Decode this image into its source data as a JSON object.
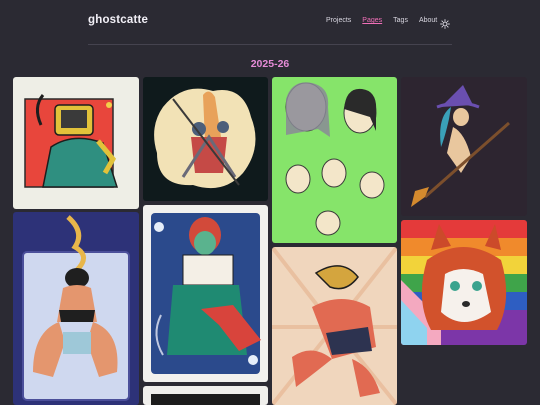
{
  "site": {
    "name": "ghostcatte"
  },
  "nav": {
    "items": [
      {
        "label": "Projects"
      },
      {
        "label": "Pages"
      },
      {
        "label": "Tags"
      },
      {
        "label": "About"
      }
    ],
    "theme_icon": "sun-icon"
  },
  "gallery": {
    "heading": "2025-26",
    "items": [
      {
        "icon": "artwork-tv-head-character"
      },
      {
        "icon": "artwork-dragon-knights"
      },
      {
        "icon": "artwork-character-sketches"
      },
      {
        "icon": "artwork-witch-on-broom"
      },
      {
        "icon": "artwork-seated-figure"
      },
      {
        "icon": "artwork-queen-card"
      },
      {
        "icon": "artwork-crouching-figure"
      },
      {
        "icon": "artwork-fox-portrait"
      },
      {
        "icon": "artwork-partial-bottom"
      }
    ]
  },
  "colors": {
    "accent": "#f06fb8",
    "heading": "#e58bd7",
    "background": "#2b2a33"
  }
}
